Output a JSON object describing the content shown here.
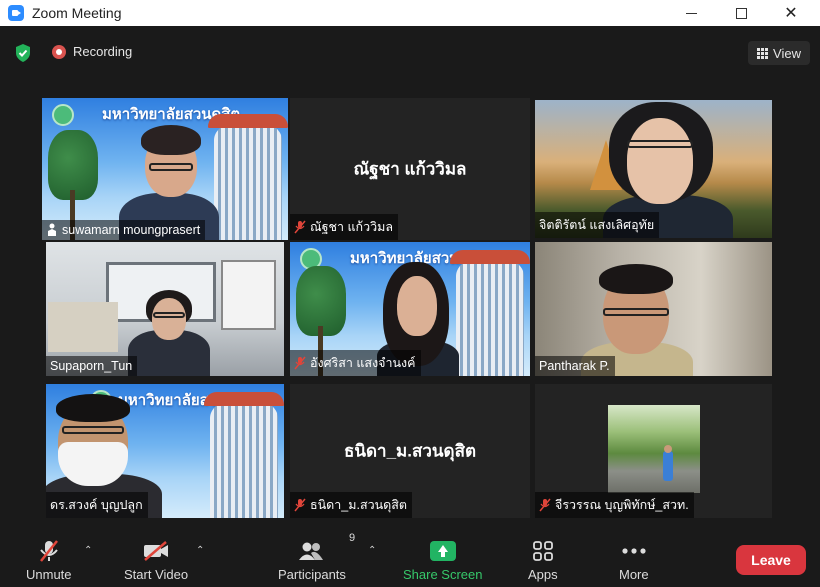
{
  "window": {
    "title": "Zoom Meeting"
  },
  "top_bar": {
    "recording_label": "Recording",
    "view_label": "View"
  },
  "tiles": [
    {
      "name": "suwamarn moungprasert",
      "muted": false,
      "active": true,
      "background": "university"
    },
    {
      "name": "ณัฐชา แก้ววิมล",
      "center_text": "ณัฐชา แก้ววิมล",
      "muted": true,
      "video": false
    },
    {
      "name": "จิตติรัตน์ แสงเลิศอุทัย",
      "muted": false,
      "background": "sunset"
    },
    {
      "name": "Supaporn_Tun",
      "muted": false,
      "background": "office"
    },
    {
      "name": "อังศริสา แสงจำนงค์",
      "muted": true,
      "background": "university"
    },
    {
      "name": "Pantharak P.",
      "muted": false,
      "background": "room"
    },
    {
      "name": "ดร.สวงค์ บุญปลูก",
      "muted": false,
      "background": "university"
    },
    {
      "name": "ธนิดา_ม.สวนดุสิต",
      "center_text": "ธนิดา_ม.สวนดุสิต",
      "muted": true,
      "video": false
    },
    {
      "name": "จีรวรรณ บุญพิทักษ์_สวท.",
      "muted": true,
      "background": "park-photo"
    }
  ],
  "university_banner": "มหาวิทยาลัยสวนดุสิต",
  "toolbar": {
    "unmute": "Unmute",
    "start_video": "Start Video",
    "participants": "Participants",
    "participants_count": "9",
    "share_screen": "Share Screen",
    "apps": "Apps",
    "more": "More",
    "leave": "Leave"
  },
  "colors": {
    "active_speaker_border": "#e8ef7c",
    "share_green": "#22b463",
    "leave_red": "#d9363e"
  }
}
